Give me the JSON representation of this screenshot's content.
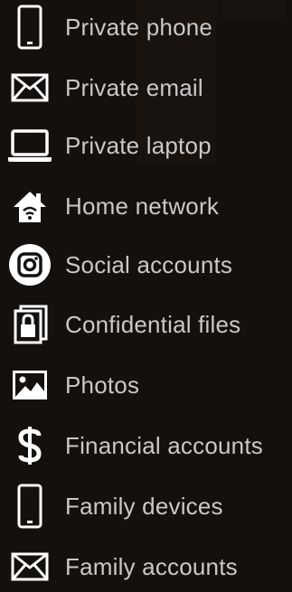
{
  "items": [
    {
      "label": "Private phone",
      "icon": "phone-icon"
    },
    {
      "label": "Private email",
      "icon": "envelope-icon"
    },
    {
      "label": "Private laptop",
      "icon": "laptop-icon"
    },
    {
      "label": "Home network",
      "icon": "home-wifi-icon"
    },
    {
      "label": "Social accounts",
      "icon": "instagram-icon"
    },
    {
      "label": "Confidential files",
      "icon": "locked-files-icon"
    },
    {
      "label": "Photos",
      "icon": "photo-icon"
    },
    {
      "label": "Financial accounts",
      "icon": "dollar-icon"
    },
    {
      "label": "Family devices",
      "icon": "phone-icon"
    },
    {
      "label": "Family accounts",
      "icon": "envelope-icon"
    }
  ],
  "colors": {
    "background": "#14100d",
    "text": "#c9c9c9",
    "icon": "#ffffff"
  }
}
